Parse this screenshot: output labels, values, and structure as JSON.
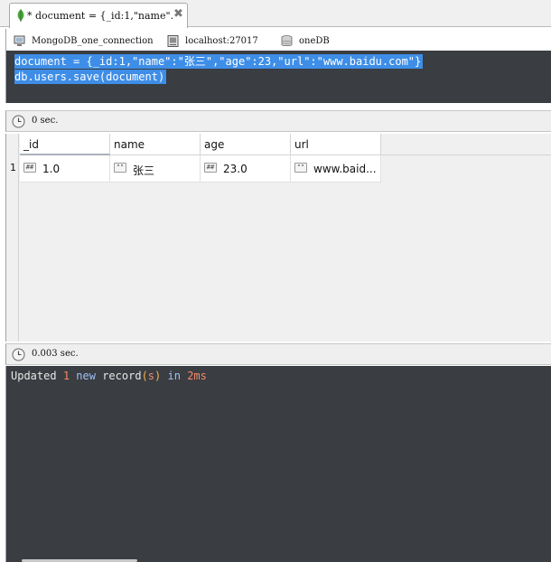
{
  "tab": {
    "title": "* document = {_id:1,\"name\"…",
    "close_glyph": "✖",
    "icon": "mongodb-leaf-icon"
  },
  "connection": {
    "connection_name": "MongoDB_one_connection",
    "server": "localhost:27017",
    "database": "oneDB",
    "icons": [
      "connection-icon",
      "server-icon",
      "database-icon"
    ]
  },
  "editor": {
    "lines": [
      "document = {_id:1,\"name\":\"张三\",\"age\":23,\"url\":\"www.baidu.com\"}",
      "db.users.save(document)"
    ],
    "selection_color": "#3e8ee8"
  },
  "query_time": "0 sec.",
  "results": {
    "columns": [
      "_id",
      "name",
      "age",
      "url"
    ],
    "rows": [
      {
        "num": "1",
        "cells": [
          {
            "type_icon": "##",
            "value": "1.0"
          },
          {
            "type_icon": "\"\"",
            "value": "张三"
          },
          {
            "type_icon": "##",
            "value": "23.0"
          },
          {
            "type_icon": "\"\"",
            "value": "www.baid..."
          }
        ]
      }
    ]
  },
  "save_time": "0.003 sec.",
  "output": {
    "words": [
      "Updated",
      "1",
      "new",
      "record",
      "(",
      "s",
      ")",
      "in",
      "2ms"
    ]
  },
  "colors": {
    "editor_bg": "#3a3d41",
    "number": "#f58a6a",
    "keyword": "#9fc0f5",
    "paren": "#f7b34a"
  }
}
